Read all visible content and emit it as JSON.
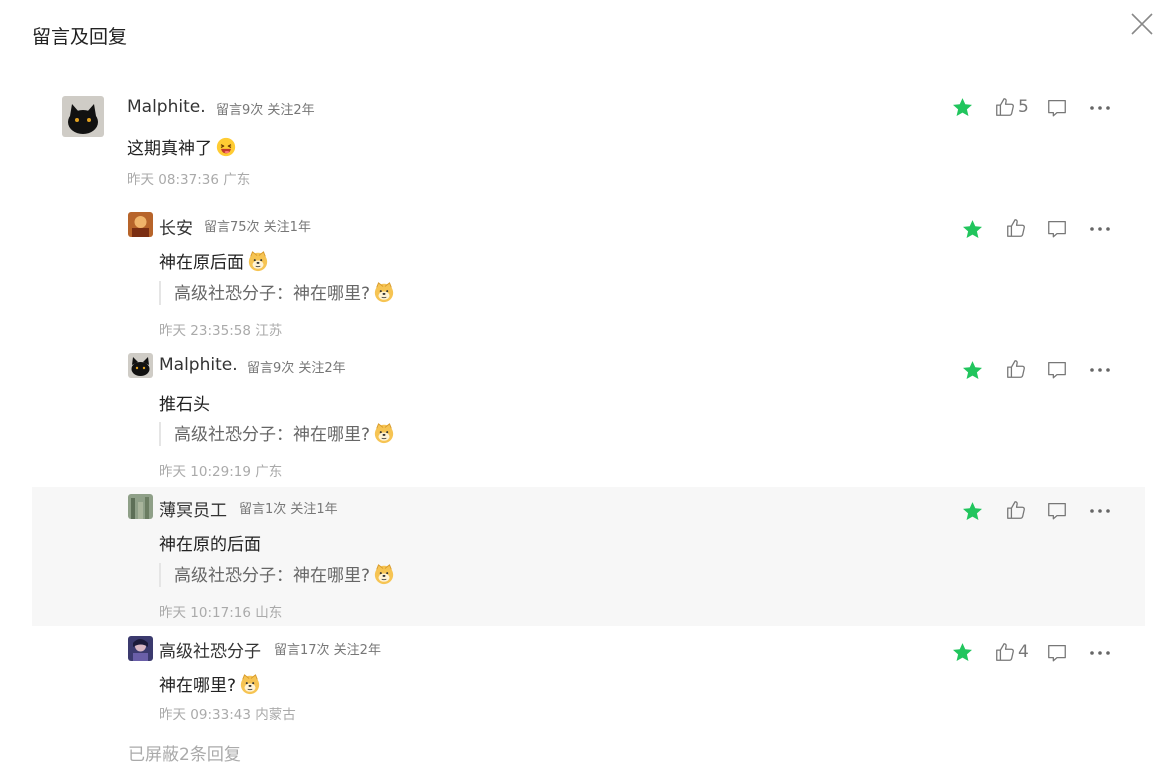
{
  "header": {
    "title": "留言及回复"
  },
  "main_comment": {
    "name": "Malphite.",
    "meta": "留言9次 关注2年",
    "text": "这期真神了",
    "time": "昨天 08:37:36 广东",
    "likes": "5"
  },
  "replies": [
    {
      "name": "长安",
      "meta": "留言75次 关注1年",
      "text": "神在原后面",
      "quote": "高级社恐分子：神在哪里?",
      "time": "昨天 23:35:58 江苏",
      "likes": ""
    },
    {
      "name": "Malphite.",
      "meta": "留言9次 关注2年",
      "text": "推石头",
      "quote": "高级社恐分子：神在哪里?",
      "time": "昨天 10:29:19 广东",
      "likes": ""
    },
    {
      "name": "薄冥员工",
      "meta": "留言1次 关注1年",
      "text": "神在原的后面",
      "quote": "高级社恐分子：神在哪里?",
      "time": "昨天 10:17:16 山东",
      "likes": ""
    },
    {
      "name": "高级社恐分子",
      "meta": "留言17次 关注2年",
      "text": "神在哪里?",
      "time": "昨天 09:33:43 内蒙古",
      "likes": "4"
    }
  ],
  "footer": {
    "hidden_replies": "已屏蔽2条回复"
  },
  "colors": {
    "star": "#21c55d",
    "icon": "#777777",
    "highlight_bg": "#f7f7f7"
  },
  "icons": [
    "close-icon",
    "star-icon",
    "thumb-up-icon",
    "reply-icon",
    "more-icon",
    "laughing-emoji",
    "doge-emoji"
  ]
}
